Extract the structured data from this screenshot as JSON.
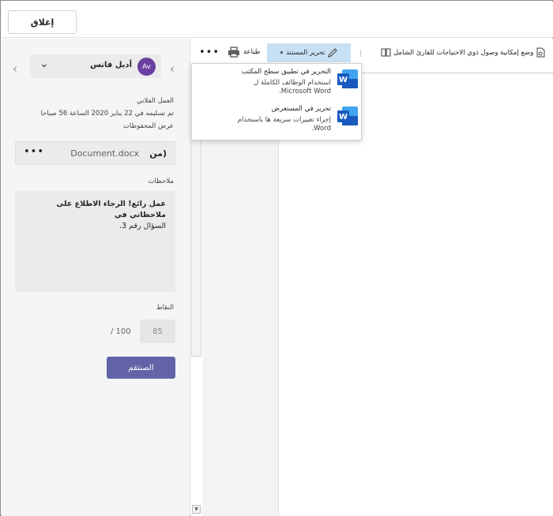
{
  "header": {
    "close_label": "إغلاق"
  },
  "student": {
    "initials": "Av",
    "name": "أديل فانس"
  },
  "assignment": {
    "title": "العمل الفلاني",
    "turned_in": "تم تسليمه في 22 يناير 2020 الساعة 56 صباحا",
    "view_saved": "عرض المحفوظات"
  },
  "file": {
    "from_label": "من)",
    "name": "Document.docx"
  },
  "feedback": {
    "label": "ملاحظات",
    "text_bold": "عمل رائع! الرجاء الاطلاع على ملاحظاتي في",
    "text_rest": "السؤال رقم 3."
  },
  "points": {
    "label": "النقاط",
    "value": "85",
    "total": "/ 100"
  },
  "return_label": "الصنتقم",
  "toolbar": {
    "more": "•••",
    "print_label": "طباعة",
    "edit_label": "تحرير المستند",
    "accessibility_label": "وضع إمكانية وصول ذوي الاحتياجات للقارئ الشامل"
  },
  "edit_menu": [
    {
      "title": "التحرير في تطبيق سطح المكتب",
      "desc": "استخدام الوظائف الكاملة ل Microsoft Word."
    },
    {
      "title": "تحرير في المستعرض",
      "desc": "إجراء تغييرات سريعة ها باستخدام Word."
    }
  ],
  "colors": {
    "accent": "#6264a7",
    "avatar": "#6b3fa0",
    "edit_highlight": "#c7e0f4",
    "word_blue": "#185abd"
  }
}
